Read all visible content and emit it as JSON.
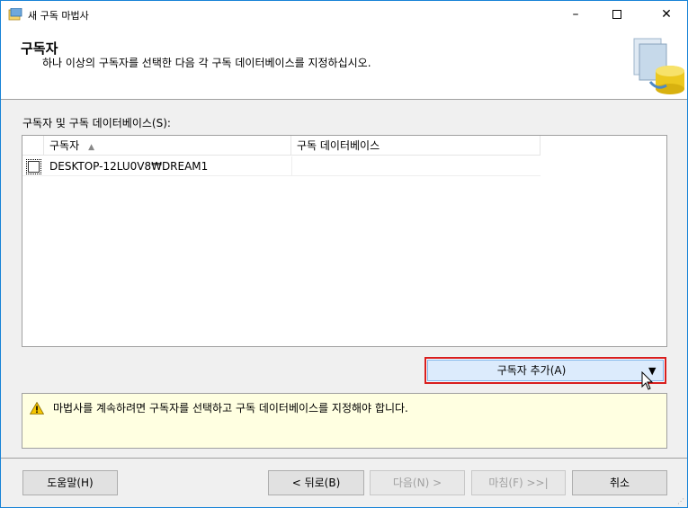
{
  "window": {
    "title": "새 구독 마법사",
    "minimize": "–",
    "close": "✕"
  },
  "header": {
    "title": "구독자",
    "description": "하나 이상의 구독자를 선택한 다음 각 구독 데이터베이스를 지정하십시오."
  },
  "list": {
    "label": "구독자 및 구독 데이터베이스(S):",
    "columns": {
      "subscriber": "구독자",
      "database": "구독 데이터베이스"
    },
    "sort_indicator": "▲",
    "rows": [
      {
        "subscriber": "DESKTOP-12LU0V8₩DREAM1",
        "database": ""
      }
    ]
  },
  "add_subscriber": {
    "label": "구독자 추가(A)",
    "arrow": "▼"
  },
  "warning": {
    "text": "마법사를 계속하려면 구독자를 선택하고 구독 데이터베이스를 지정해야 합니다."
  },
  "buttons": {
    "help": "도움말(H)",
    "back": "< 뒤로(B)",
    "next": "다음(N) >",
    "finish": "마침(F) >>|",
    "cancel": "취소"
  },
  "colors": {
    "highlight_border": "#d81e1e",
    "button_hover": "#dcebfc",
    "warning_bg": "#ffffe1",
    "window_border": "#1883d7"
  },
  "icons": {
    "app": "wizard-app-icon",
    "header": "database-subscription-icon",
    "warning": "warning-triangle-icon",
    "cursor": "mouse-pointer-icon"
  }
}
